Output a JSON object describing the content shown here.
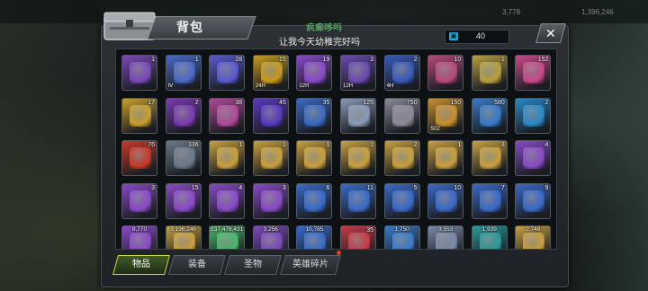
{
  "window": {
    "title": "背包",
    "player_name": "疯癫哆吗",
    "signature": "让我今天幼稚完好吗",
    "capacity": "40",
    "close_symbol": "✕"
  },
  "tabs": [
    {
      "label": "物品",
      "active": true
    },
    {
      "label": "装备",
      "active": false
    },
    {
      "label": "圣物",
      "active": false
    },
    {
      "label": "英雄碎片",
      "active": false,
      "badge": true
    }
  ],
  "background_top_values": [
    "3,778",
    "1,396,246"
  ],
  "items": [
    {
      "icon": "purple-lock-box-icon",
      "color": "#7a4ab8",
      "count": "1",
      "sub": ""
    },
    {
      "icon": "rank-iv-crystal-icon",
      "color": "#4a6ac8",
      "count": "1",
      "sub": "IV"
    },
    {
      "icon": "gem-pile-icon",
      "color": "#5a5ad0",
      "count": "28",
      "sub": ""
    },
    {
      "icon": "gold-24h-card-icon",
      "color": "#c89a20",
      "count": "15",
      "sub": "24H"
    },
    {
      "icon": "purple-12h-card-icon",
      "color": "#8a4ac8",
      "count": "19",
      "sub": "12H"
    },
    {
      "icon": "purple-12h-card-icon",
      "color": "#6a4ab0",
      "count": "3",
      "sub": "12H"
    },
    {
      "icon": "blue-4h-card-icon",
      "color": "#3a5ab8",
      "count": "2",
      "sub": "4H"
    },
    {
      "icon": "pink-potion-icon",
      "color": "#b84a7a",
      "count": "10",
      "sub": ""
    },
    {
      "icon": "gold-coin-badge-icon",
      "color": "#b8a040",
      "count": "1",
      "sub": ""
    },
    {
      "icon": "pink-mushroom-icon",
      "color": "#c84a8a",
      "count": "152",
      "sub": ""
    },
    {
      "icon": "gold-coin-medal-icon",
      "color": "#c8a030",
      "count": "17",
      "sub": ""
    },
    {
      "icon": "purple-cube-icon",
      "color": "#7a3ab0",
      "count": "2",
      "sub": ""
    },
    {
      "icon": "film-reel-icon",
      "color": "#b04a9a",
      "count": "38",
      "sub": ""
    },
    {
      "icon": "purple-star-orb-icon",
      "color": "#5a3ac0",
      "count": "45",
      "sub": ""
    },
    {
      "icon": "blue-star-badge-icon",
      "color": "#3a6ac0",
      "count": "35",
      "sub": ""
    },
    {
      "icon": "silver-medal-icon",
      "color": "#8a9ab8",
      "count": "125",
      "sub": ""
    },
    {
      "icon": "poker-chip-icon",
      "color": "#8a8a9a",
      "count": "750",
      "sub": ""
    },
    {
      "icon": "gold-s02-token-icon",
      "color": "#c89030",
      "count": "150",
      "sub": "S02"
    },
    {
      "icon": "blue-ticket-icon",
      "color": "#3a7ac8",
      "count": "580",
      "sub": ""
    },
    {
      "icon": "blue-b-coin-icon",
      "color": "#2a8ac8",
      "count": "2",
      "sub": ""
    },
    {
      "icon": "red-gear-chip-icon",
      "color": "#c83a2a",
      "count": "76",
      "sub": ""
    },
    {
      "icon": "rocket-icon",
      "color": "#6a7a8a",
      "count": "336",
      "sub": ""
    },
    {
      "icon": "gold-boots-crate-icon",
      "color": "#c8a040",
      "count": "1",
      "sub": ""
    },
    {
      "icon": "gold-boots-crate-icon",
      "color": "#c8a040",
      "count": "1",
      "sub": ""
    },
    {
      "icon": "gold-blades-crate-icon",
      "color": "#c8a040",
      "count": "1",
      "sub": ""
    },
    {
      "icon": "gold-boots-crate-icon",
      "color": "#c8a040",
      "count": "1",
      "sub": ""
    },
    {
      "icon": "gold-gloves-crate-icon",
      "color": "#c8a040",
      "count": "2",
      "sub": ""
    },
    {
      "icon": "gold-gloves-crate-icon",
      "color": "#c8a040",
      "count": "1",
      "sub": ""
    },
    {
      "icon": "gold-blades-crate-icon",
      "color": "#c8a040",
      "count": "3",
      "sub": ""
    },
    {
      "icon": "purple-gloves-crate-icon",
      "color": "#8a4ac8",
      "count": "4",
      "sub": ""
    },
    {
      "icon": "purple-blades-crate-icon",
      "color": "#8a4ac8",
      "count": "3",
      "sub": ""
    },
    {
      "icon": "purple-armor-crate-icon",
      "color": "#8a4ac8",
      "count": "15",
      "sub": ""
    },
    {
      "icon": "purple-gloves-crate-icon",
      "color": "#8a4ac8",
      "count": "4",
      "sub": ""
    },
    {
      "icon": "purple-boots-crate-icon",
      "color": "#8a4ac8",
      "count": "3",
      "sub": ""
    },
    {
      "icon": "blue-blades-crate-icon",
      "color": "#3a6ac8",
      "count": "6",
      "sub": ""
    },
    {
      "icon": "blue-boots-crate-icon",
      "color": "#3a6ac8",
      "count": "11",
      "sub": ""
    },
    {
      "icon": "blue-gloves-crate-icon",
      "color": "#3a6ac8",
      "count": "5",
      "sub": ""
    },
    {
      "icon": "blue-gloves-crate-icon",
      "color": "#3a6ac8",
      "count": "10",
      "sub": ""
    },
    {
      "icon": "blue-boots-crate-icon",
      "color": "#3a6ac8",
      "count": "7",
      "sub": ""
    },
    {
      "icon": "blue-blades-crate-icon",
      "color": "#3a6ac8",
      "count": "9",
      "sub": ""
    },
    {
      "icon": "purple-orb-icon",
      "color": "#8a4ac8",
      "count": "8,770",
      "sub": "",
      "big": true
    },
    {
      "icon": "gold-orb-icon",
      "color": "#c8a040",
      "count": "3,196,246",
      "sub": "",
      "big": true
    },
    {
      "icon": "green-orb-icon",
      "color": "#4ab86a",
      "count": "137,476,431",
      "sub": "",
      "big": true
    },
    {
      "icon": "purple-orb-icon",
      "color": "#7a4ab8",
      "count": "3,256",
      "sub": "",
      "big": true
    },
    {
      "icon": "blue-orb-icon",
      "color": "#3a6ac8",
      "count": "10,785",
      "sub": "",
      "big": true
    },
    {
      "icon": "red-orb-icon",
      "color": "#c83a4a",
      "count": "35",
      "sub": "",
      "big": false
    },
    {
      "icon": "blue-wing-icon",
      "color": "#3a7ac8",
      "count": "1,750",
      "sub": "",
      "big": true
    },
    {
      "icon": "silver-gem-icon",
      "color": "#7a8aa8",
      "count": "9,553",
      "sub": "",
      "big": true
    },
    {
      "icon": "teal-potion-icon",
      "color": "#2a9a9a",
      "count": "1,939",
      "sub": "",
      "big": true
    },
    {
      "icon": "gold-dust-icon",
      "color": "#c8a040",
      "count": "2,748",
      "sub": "",
      "big": true
    }
  ]
}
